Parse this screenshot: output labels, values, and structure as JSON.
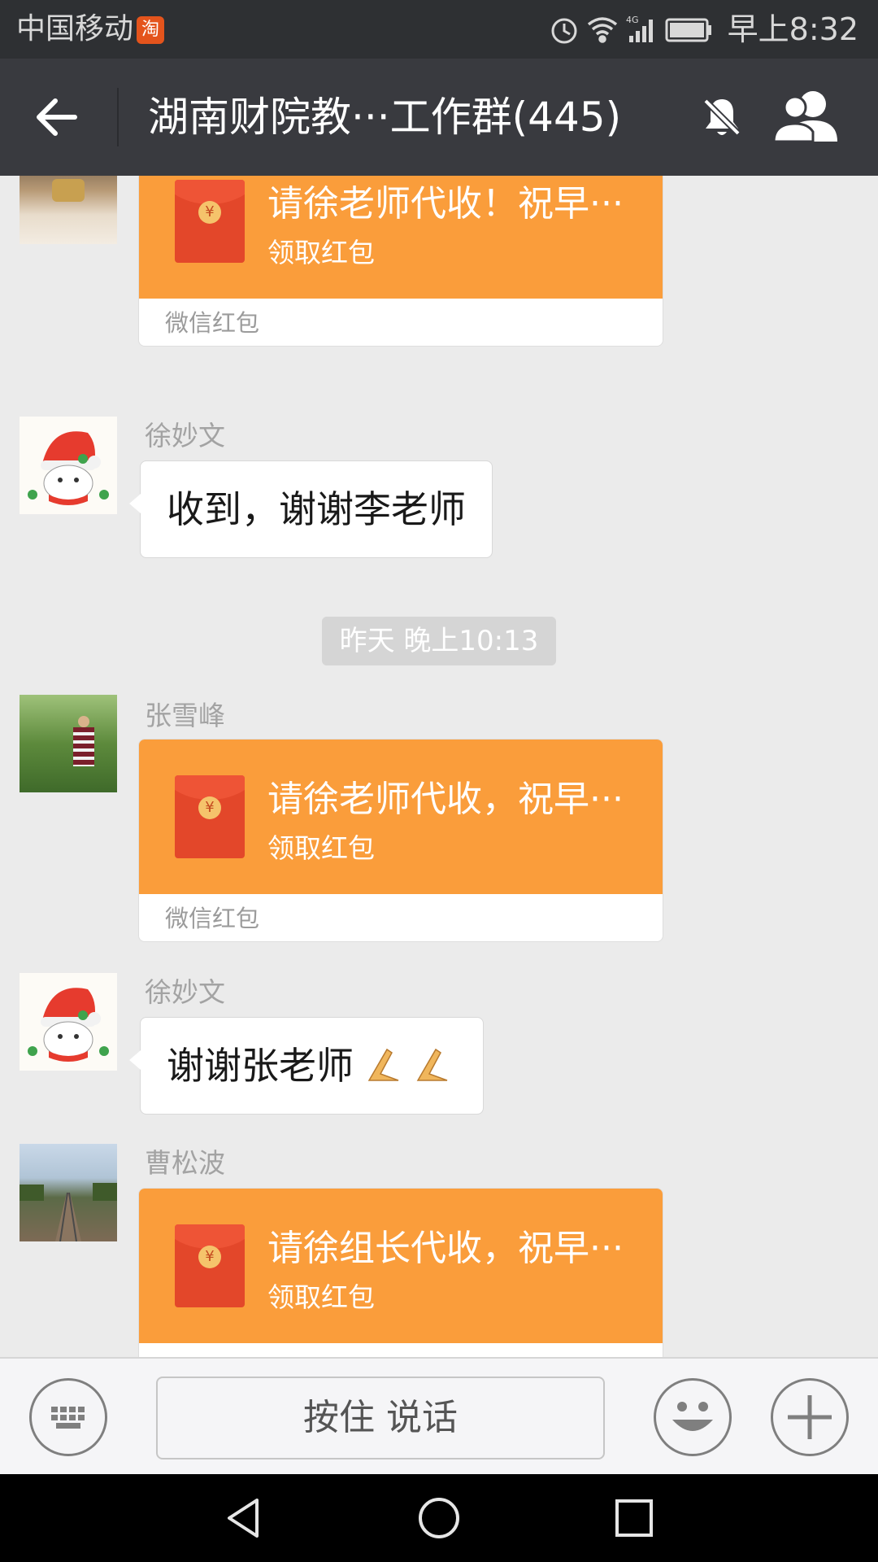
{
  "status_bar": {
    "carrier": "中国移动",
    "taobao_badge": "淘",
    "network": "4G",
    "time": "早上8:32"
  },
  "title_bar": {
    "title": "湖南财院教···工作群(445)"
  },
  "chat": {
    "messages": [
      {
        "type": "red_packet",
        "sender": "",
        "title": "请徐老师代收！祝早···",
        "subtitle": "领取红包",
        "footer": "微信红包"
      },
      {
        "type": "text",
        "sender": "徐妙文",
        "text": "收到，谢谢李老师"
      },
      {
        "type": "timestamp",
        "text": "昨天 晚上10:13"
      },
      {
        "type": "red_packet",
        "sender": "张雪峰",
        "title": "请徐老师代收，祝早···",
        "subtitle": "领取红包",
        "footer": "微信红包"
      },
      {
        "type": "text",
        "sender": "徐妙文",
        "text": "谢谢张老师"
      },
      {
        "type": "red_packet",
        "sender": "曹松波",
        "title": "请徐组长代收，祝早···",
        "subtitle": "领取红包",
        "footer": ""
      }
    ]
  },
  "input_bar": {
    "voice_button_label": "按住 说话"
  },
  "colors": {
    "statusbar_bg": "#2e3033",
    "titlebar_bg": "#393a3f",
    "chat_bg": "#ebebeb",
    "red_packet": "#fa9d3b",
    "envelope": "#e3472a"
  },
  "icons": [
    "back-arrow-icon",
    "mute-bell-icon",
    "group-members-icon",
    "keyboard-icon",
    "emoji-icon",
    "plus-icon",
    "nav-back-icon",
    "nav-home-icon",
    "nav-recents-icon"
  ]
}
